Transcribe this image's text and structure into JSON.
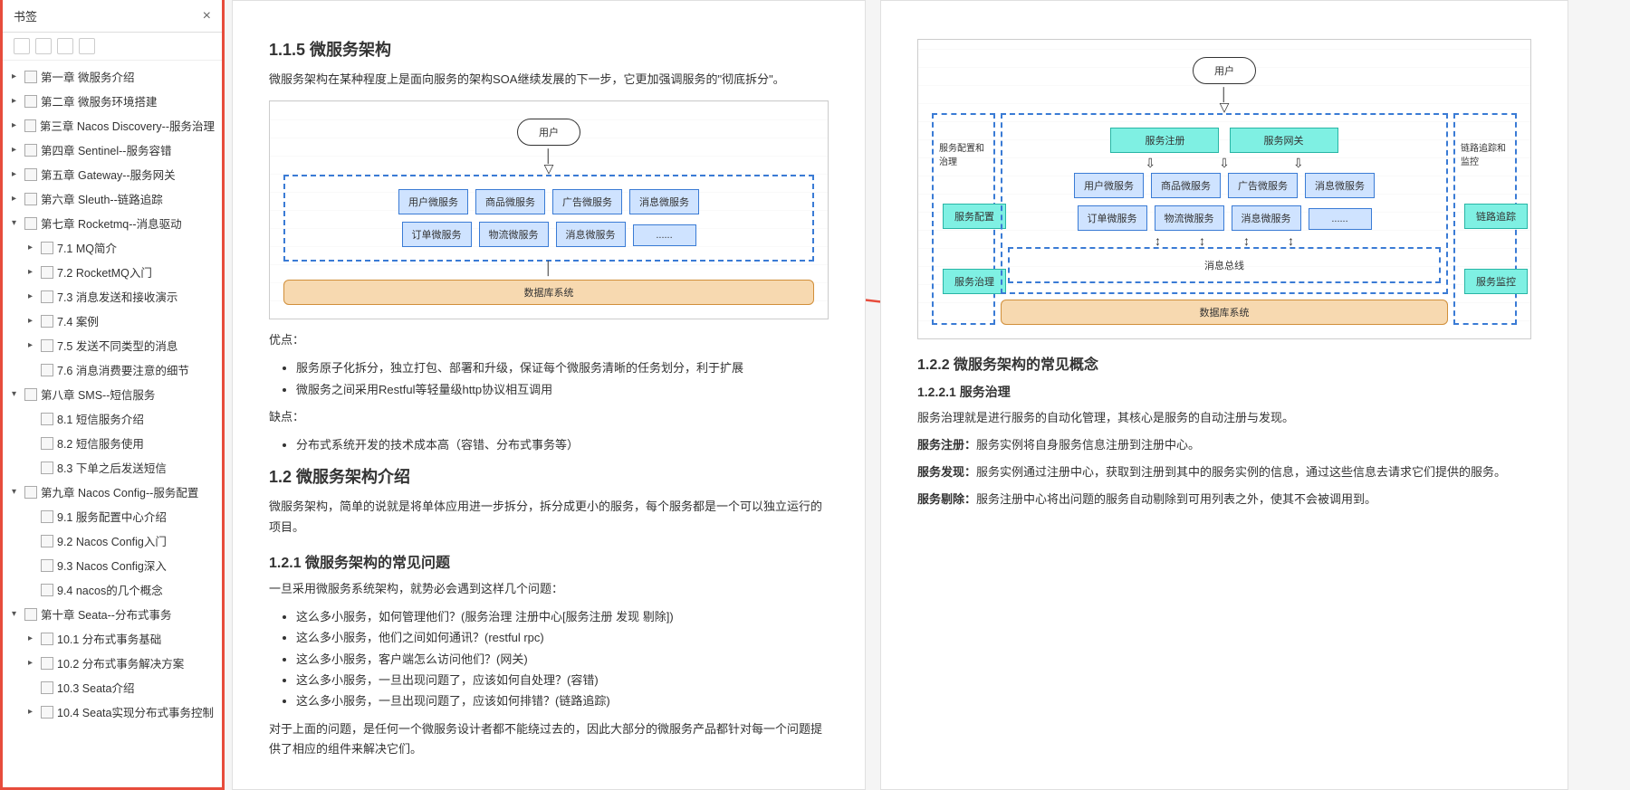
{
  "sidebar": {
    "title": "书签",
    "items": [
      {
        "label": "第一章 微服务介绍",
        "indent": 0,
        "arrow": "▸"
      },
      {
        "label": "第二章 微服务环境搭建",
        "indent": 0,
        "arrow": "▸"
      },
      {
        "label": "第三章 Nacos Discovery--服务治理",
        "indent": 0,
        "arrow": "▸"
      },
      {
        "label": "第四章 Sentinel--服务容错",
        "indent": 0,
        "arrow": "▸"
      },
      {
        "label": "第五章 Gateway--服务网关",
        "indent": 0,
        "arrow": "▸"
      },
      {
        "label": "第六章 Sleuth--链路追踪",
        "indent": 0,
        "arrow": "▸"
      },
      {
        "label": "第七章 Rocketmq--消息驱动",
        "indent": 0,
        "arrow": "▾"
      },
      {
        "label": "7.1 MQ简介",
        "indent": 1,
        "arrow": "▸"
      },
      {
        "label": "7.2 RocketMQ入门",
        "indent": 1,
        "arrow": "▸"
      },
      {
        "label": "7.3 消息发送和接收演示",
        "indent": 1,
        "arrow": "▸"
      },
      {
        "label": "7.4 案例",
        "indent": 1,
        "arrow": "▸"
      },
      {
        "label": "7.5 发送不同类型的消息",
        "indent": 1,
        "arrow": "▸"
      },
      {
        "label": "7.6 消息消费要注意的细节",
        "indent": 1,
        "arrow": ""
      },
      {
        "label": "第八章 SMS--短信服务",
        "indent": 0,
        "arrow": "▾"
      },
      {
        "label": "8.1 短信服务介绍",
        "indent": 1,
        "arrow": ""
      },
      {
        "label": "8.2 短信服务使用",
        "indent": 1,
        "arrow": ""
      },
      {
        "label": "8.3 下单之后发送短信",
        "indent": 1,
        "arrow": ""
      },
      {
        "label": "第九章 Nacos Config--服务配置",
        "indent": 0,
        "arrow": "▾"
      },
      {
        "label": "9.1 服务配置中心介绍",
        "indent": 1,
        "arrow": ""
      },
      {
        "label": "9.2 Nacos Config入门",
        "indent": 1,
        "arrow": ""
      },
      {
        "label": "9.3 Nacos Config深入",
        "indent": 1,
        "arrow": ""
      },
      {
        "label": "9.4 nacos的几个概念",
        "indent": 1,
        "arrow": ""
      },
      {
        "label": "第十章 Seata--分布式事务",
        "indent": 0,
        "arrow": "▾"
      },
      {
        "label": "10.1 分布式事务基础",
        "indent": 1,
        "arrow": "▸"
      },
      {
        "label": "10.2 分布式事务解决方案",
        "indent": 1,
        "arrow": "▸"
      },
      {
        "label": "10.3 Seata介绍",
        "indent": 1,
        "arrow": ""
      },
      {
        "label": "10.4 Seata实现分布式事务控制",
        "indent": 1,
        "arrow": "▸"
      }
    ]
  },
  "page1": {
    "h115": "1.1.5 微服务架构",
    "p115": "微服务架构在某种程度上是面向服务的架构SOA继续发展的下一步，它更加强调服务的\"彻底拆分\"。",
    "diag1": {
      "user": "用户",
      "row1": [
        "用户微服务",
        "商品微服务",
        "广告微服务",
        "消息微服务"
      ],
      "row2": [
        "订单微服务",
        "物流微服务",
        "消息微服务",
        "......"
      ],
      "db": "数据库系统"
    },
    "adv_label": "优点：",
    "adv": [
      "服务原子化拆分，独立打包、部署和升级，保证每个微服务清晰的任务划分，利于扩展",
      "微服务之间采用Restful等轻量级http协议相互调用"
    ],
    "dis_label": "缺点：",
    "dis": [
      "分布式系统开发的技术成本高（容错、分布式事务等）"
    ],
    "h12": "1.2 微服务架构介绍",
    "p12": "微服务架构，简单的说就是将单体应用进一步拆分，拆分成更小的服务，每个服务都是一个可以独立运行的项目。",
    "h121": "1.2.1 微服务架构的常见问题",
    "p121": "一旦采用微服务系统架构，就势必会遇到这样几个问题：",
    "qs": [
      "这么多小服务，如何管理他们？(服务治理 注册中心[服务注册 发现 剔除])",
      "这么多小服务，他们之间如何通讯？(restful rpc)",
      "这么多小服务，客户端怎么访问他们？(网关)",
      "这么多小服务，一旦出现问题了，应该如何自处理？(容错)",
      "这么多小服务，一旦出现问题了，应该如何排错？(链路追踪)"
    ],
    "p121b": "对于上面的问题，是任何一个微服务设计者都不能绕过去的，因此大部分的微服务产品都针对每一个问题提供了相应的组件来解决它们。"
  },
  "page2": {
    "diag2": {
      "user": "用户",
      "cfg_group": "服务配置和治理",
      "cfg": "服务配置",
      "gov": "服务治理",
      "reg": "服务注册",
      "gw": "服务网关",
      "row1": [
        "用户微服务",
        "商品微服务",
        "广告微服务",
        "消息微服务"
      ],
      "row2": [
        "订单微服务",
        "物流微服务",
        "消息微服务",
        "......"
      ],
      "bus": "消息总线",
      "db": "数据库系统",
      "trace_group": "链路追踪和监控",
      "trace": "链路追踪",
      "mon": "服务监控"
    },
    "h122": "1.2.2 微服务架构的常见概念",
    "h1221": "1.2.2.1 服务治理",
    "p1221": "服务治理就是进行服务的自动化管理，其核心是服务的自动注册与发现。",
    "reg_b": "服务注册：",
    "reg_t": "服务实例将自身服务信息注册到注册中心。",
    "dis_b": "服务发现：",
    "dis_t": "服务实例通过注册中心，获取到注册到其中的服务实例的信息，通过这些信息去请求它们提供的服务。",
    "rem_b": "服务剔除：",
    "rem_t": "服务注册中心将出问题的服务自动剔除到可用列表之外，使其不会被调用到。"
  }
}
